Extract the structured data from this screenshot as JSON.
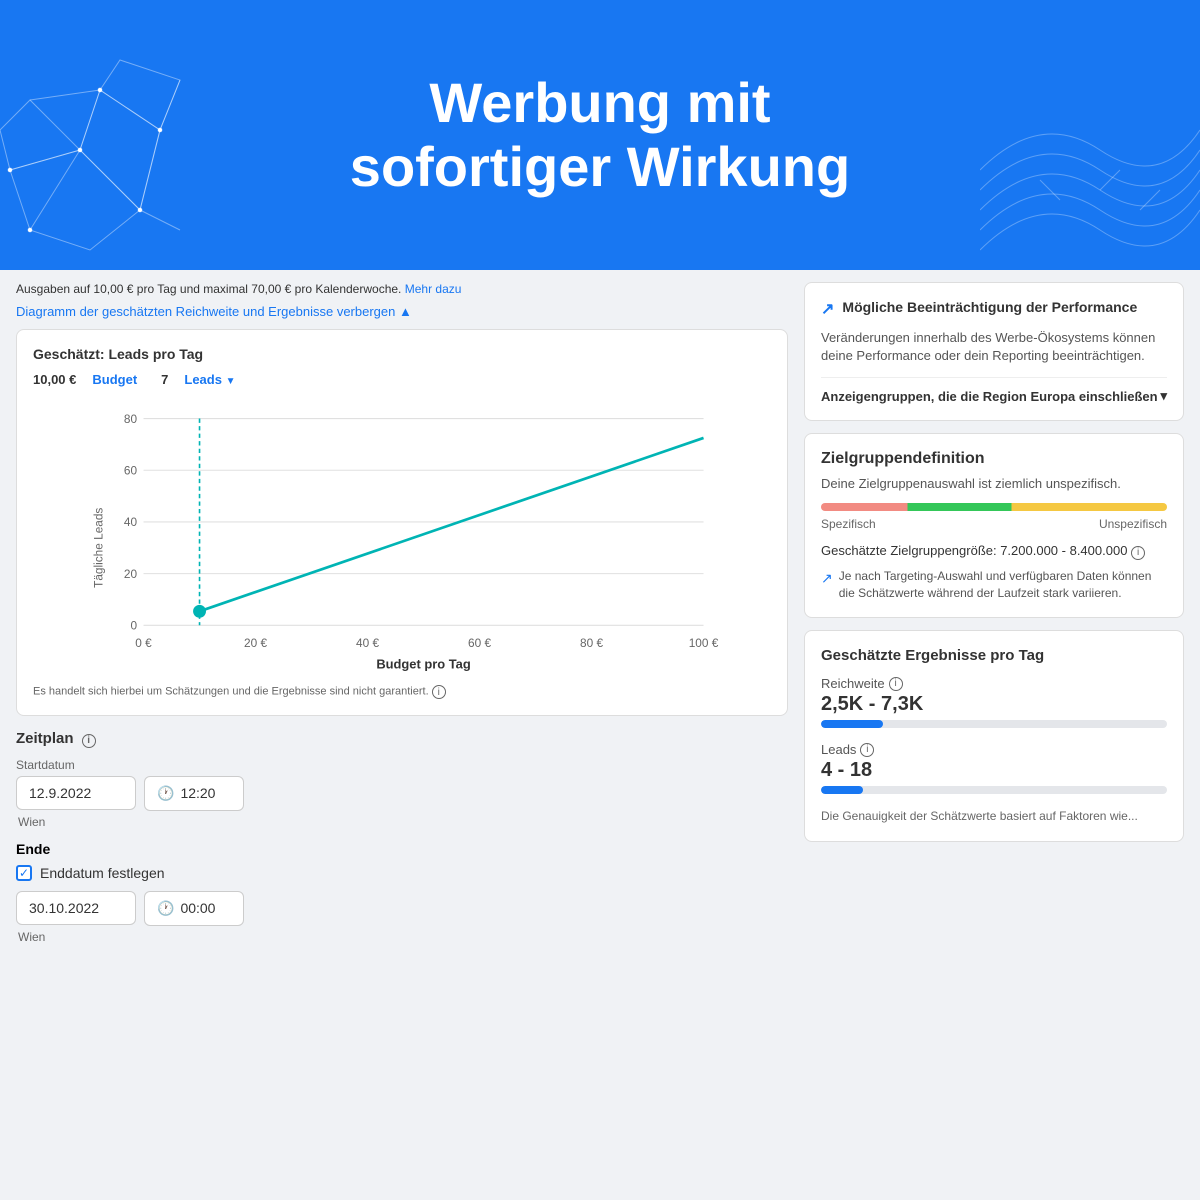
{
  "hero": {
    "line1": "Werbung mit",
    "line2": "sofortiger Wirkung"
  },
  "budget_info": {
    "text": "Ausgaben auf 10,00 € pro Tag und maximal 70,00 € pro Kalenderwoche.",
    "link": "Mehr dazu"
  },
  "chart_toggle": "Diagramm der geschätzten Reichweite und Ergebnisse verbergen ▲",
  "chart": {
    "title": "Geschätzt: Leads pro Tag",
    "budget_value": "10,00 €",
    "budget_label": "Budget",
    "leads_value": "7",
    "leads_label": "Leads",
    "y_axis": {
      "label": "Tägliche Leads",
      "values": [
        "80",
        "60",
        "40",
        "20",
        "0"
      ]
    },
    "x_axis": {
      "label": "Budget pro Tag",
      "values": [
        "0 €",
        "20 €",
        "40 €",
        "60 €",
        "80 €",
        "100 €"
      ]
    },
    "note": "Es handelt sich hierbei um Schätzungen und die Ergebnisse sind nicht garantiert."
  },
  "zeitplan": {
    "title": "Zeitplan",
    "start_label": "Startdatum",
    "start_date": "12.9.2022",
    "start_time": "12:20",
    "start_timezone": "Wien",
    "end_label": "Ende",
    "end_checkbox_label": "Enddatum festlegen",
    "end_date": "30.10.2022",
    "end_time": "00:00",
    "end_timezone": "Wien"
  },
  "warning": {
    "title": "Mögliche Beeinträchtigung der Performance",
    "icon": "↗",
    "text": "Veränderungen innerhalb des Werbe-Ökosystems können deine Performance oder dein Reporting beeinträchtigen.",
    "accordion_label": "Anzeigengruppen, die die Region Europa einschließen"
  },
  "zielgruppe": {
    "title": "Zielgruppendefinition",
    "desc": "Deine Zielgruppenauswahl ist ziemlich unspezifisch.",
    "spectrum_left": "Spezifisch",
    "spectrum_right": "Unspezifisch",
    "size_text": "Geschätzte Zielgruppengröße: 7.200.000 - 8.400.000",
    "note": "Je nach Targeting-Auswahl und verfügbaren Daten können die Schätzwerte während der Laufzeit stark variieren."
  },
  "ergebnisse": {
    "title": "Geschätzte Ergebnisse pro Tag",
    "reichweite_label": "Reichweite",
    "reichweite_value": "2,5K - 7,3K",
    "reichweite_bar_pct": 18,
    "leads_label": "Leads",
    "leads_value": "4 - 18",
    "leads_bar_pct": 12,
    "note": "Die Genauigkeit der Schätzwerte basiert auf Faktoren wie..."
  }
}
